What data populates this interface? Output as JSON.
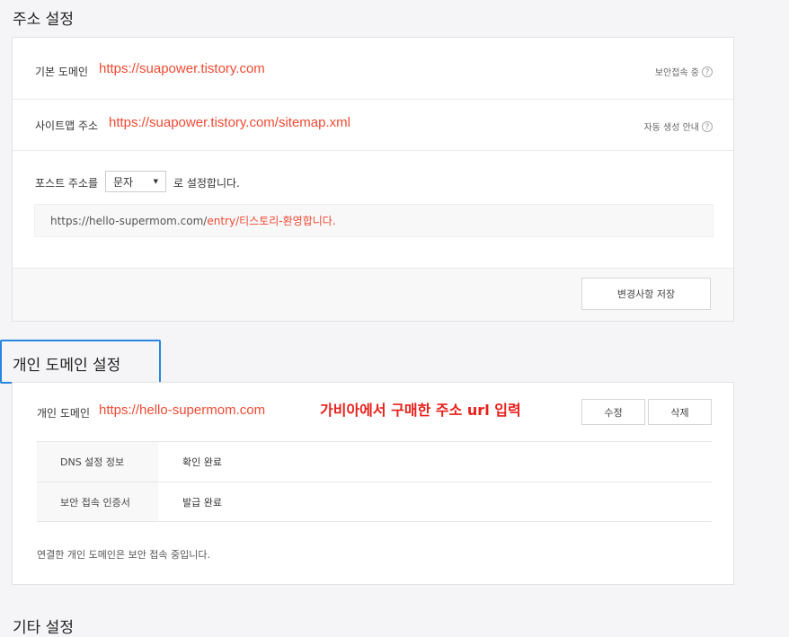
{
  "address_settings": {
    "title": "주소 설정",
    "base_domain": {
      "label": "기본 도메인",
      "url": "https://suapower.tistory.com",
      "note": "보안접속 중"
    },
    "sitemap": {
      "label": "사이트맵 주소",
      "url": "https://suapower.tistory.com/sitemap.xml",
      "note": "자동 생성 안내"
    },
    "post_address": {
      "prefix": "포스트 주소를",
      "selected": "문자",
      "suffix": "로 설정합니다.",
      "example_base": "https://hello-supermom.com/",
      "example_path": "entry/티스토리-환영합니다."
    },
    "save_label": "변경사항 저장"
  },
  "custom_domain": {
    "title": "개인 도메인 설정",
    "label": "개인 도메인",
    "url": "https://hello-supermom.com",
    "annotation": "가비아에서 구매한 주소 url 입력",
    "edit_label": "수정",
    "delete_label": "삭제",
    "rows": [
      {
        "key": "DNS 설정 정보",
        "value": "확인 완료"
      },
      {
        "key": "보안 접속 인증서",
        "value": "발급 완료"
      }
    ],
    "footer_note": "연결한 개인 도메인은 보안 접속 중입니다."
  },
  "other_settings": {
    "title": "기타 설정"
  },
  "icons": {
    "help": "help-circle-icon",
    "caret": "caret-down-icon"
  },
  "colors": {
    "accent_red": "#f04a32",
    "annotation_red": "#e8201a",
    "highlight_blue": "#2986e0"
  }
}
